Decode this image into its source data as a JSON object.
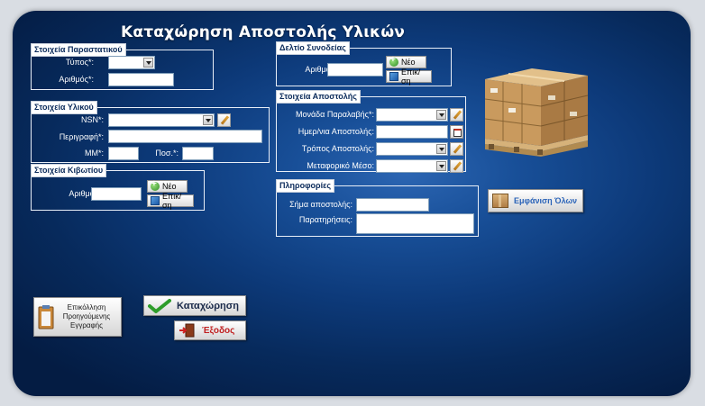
{
  "title": "Καταχώρηση Αποστολής Υλικών",
  "parastatiko": {
    "legend": "Στοιχεία Παραστατικού",
    "type_label": "Τύπος*:",
    "type_value": "",
    "number_label": "Αριθμός*:",
    "number_value": ""
  },
  "yliko": {
    "legend": "Στοιχεία Υλικού",
    "nsn_label": "NSN*:",
    "nsn_value": "",
    "description_label": "Περιγραφή*:",
    "description_value": "",
    "mm_label": "ΜΜ*:",
    "mm_value": "",
    "qty_label": "Ποσ.*:",
    "qty_value": ""
  },
  "kivotio": {
    "legend": "Στοιχεία Κιβωτίου",
    "number_label": "Αριθμός*:",
    "number_value": "",
    "new_label": "Νέο",
    "edit_label": "Επικ/ση"
  },
  "deltio": {
    "legend": "Δελτίο Συνοδείας",
    "number_label": "Αριθμός*:",
    "number_value": "",
    "new_label": "Νέο",
    "edit_label": "Επικ/ση"
  },
  "apostoli": {
    "legend": "Στοιχεία Αποστολής",
    "unit_label": "Μονάδα Παραλαβής*:",
    "unit_value": "",
    "date_label": "Ημερ/νια Αποστολής:",
    "date_value": "",
    "method_label": "Τρόπος Αποστολής:",
    "method_value": "",
    "transport_label": "Μεταφορικό Μέσο:",
    "transport_value": ""
  },
  "plirofories": {
    "legend": "Πληροφορίες",
    "signal_label": "Σήμα αποστολής:",
    "signal_value": "",
    "notes_label": "Παρατηρήσεις:",
    "notes_value": ""
  },
  "buttons": {
    "show_all": "Εμφάνιση Όλων",
    "save": "Καταχώρηση",
    "exit": "Έξοδος",
    "recall": "Επικόλληση Προηγούμενης Εγγραφής"
  },
  "colors": {
    "panel_dark": "#041c43",
    "panel_light": "#2c66b3",
    "exit_text": "#c02020",
    "save_check": "#2e9d2a"
  },
  "icons": [
    "pallet-boxes-icon",
    "check-icon",
    "exit-door-icon",
    "clipboard-icon",
    "box-icon",
    "add-icon",
    "edit-icon",
    "calendar-icon",
    "pencil-icon"
  ]
}
